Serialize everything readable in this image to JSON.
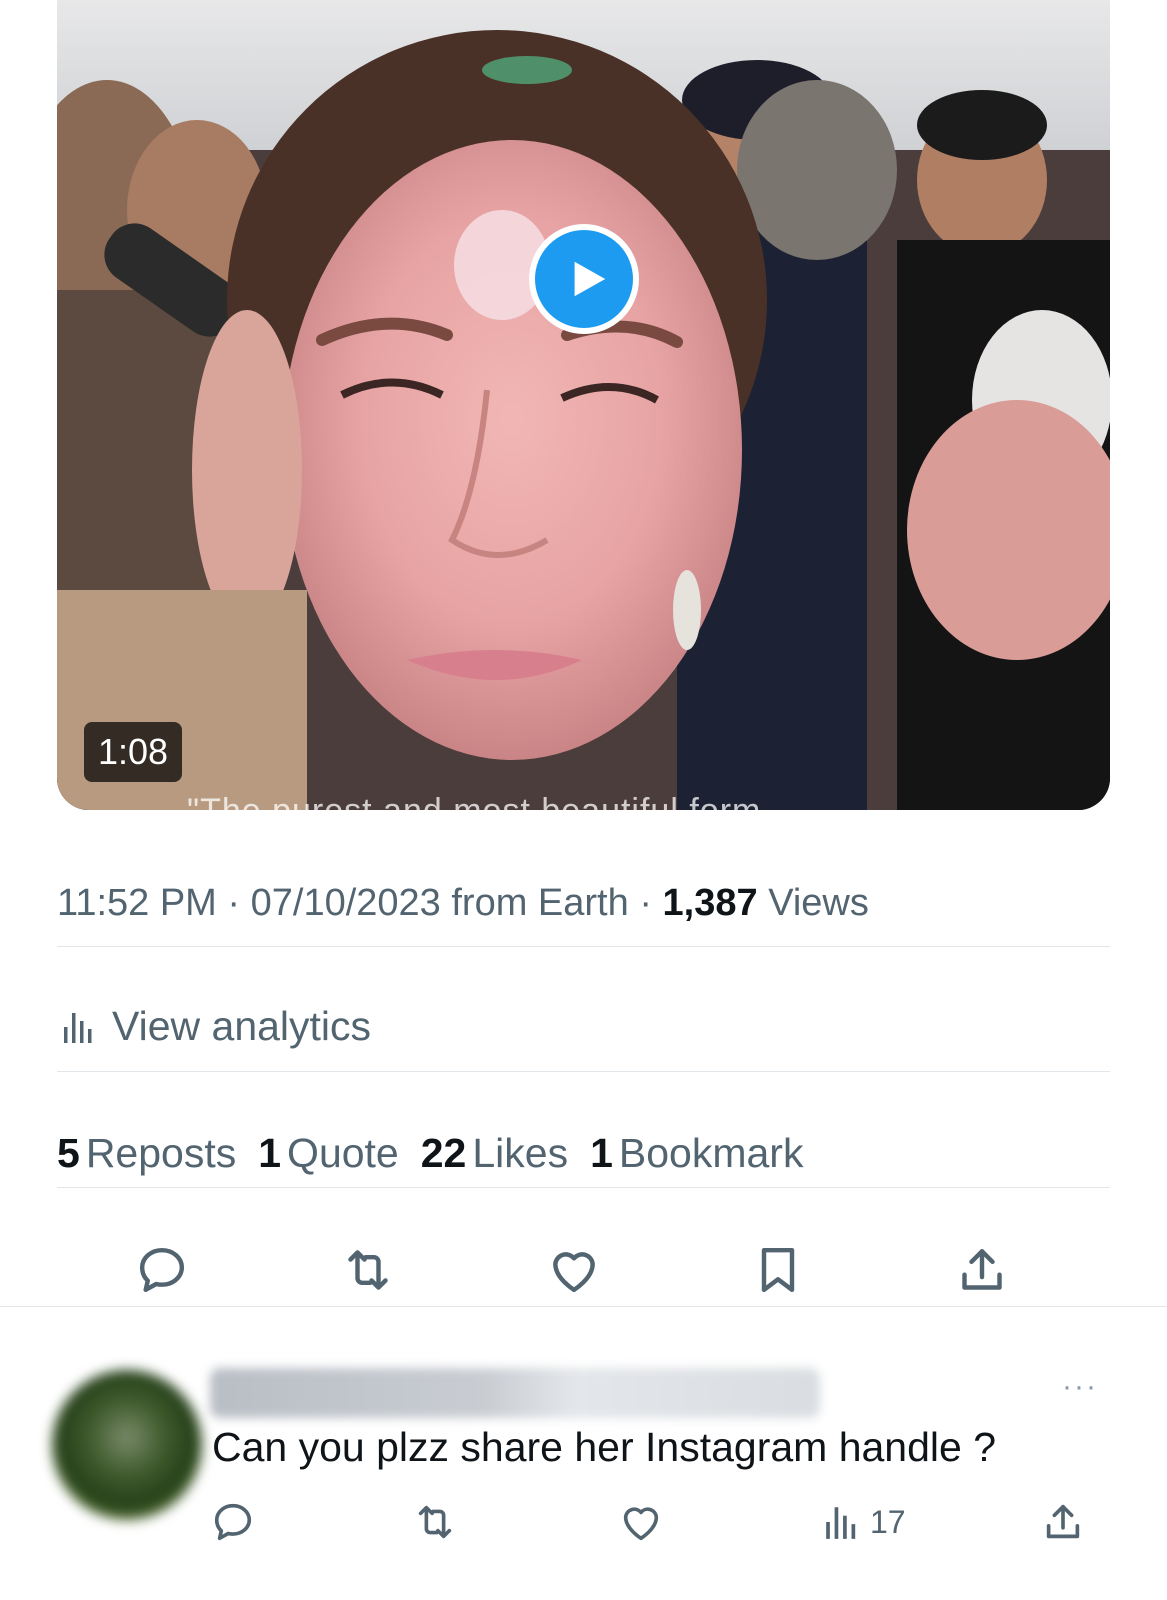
{
  "video": {
    "duration": "1:08",
    "caption_fragment": "\"The purest and most beautiful form",
    "play_icon": "play-icon"
  },
  "tweet_meta": {
    "time": "11:52 PM",
    "sep1": " · ",
    "date": "07/10/2023",
    "source": " from Earth",
    "sep2": " · ",
    "views_count": "1,387",
    "views_label": " Views"
  },
  "analytics": {
    "icon": "bar-chart-icon",
    "label": "View analytics"
  },
  "stats": [
    {
      "count": "5",
      "label": "Reposts"
    },
    {
      "count": "1",
      "label": "Quote"
    },
    {
      "count": "22",
      "label": "Likes"
    },
    {
      "count": "1",
      "label": "Bookmark"
    }
  ],
  "actions": [
    "reply-icon",
    "repost-icon",
    "like-icon",
    "bookmark-icon",
    "share-icon"
  ],
  "reply": {
    "more": "···",
    "text": "Can you plzz share her Instagram handle ?",
    "views": "17"
  },
  "colors": {
    "accent": "#1d9bf0",
    "secondary_text": "#536471",
    "primary_text": "#0f1419",
    "divider": "#e1e6ea"
  }
}
